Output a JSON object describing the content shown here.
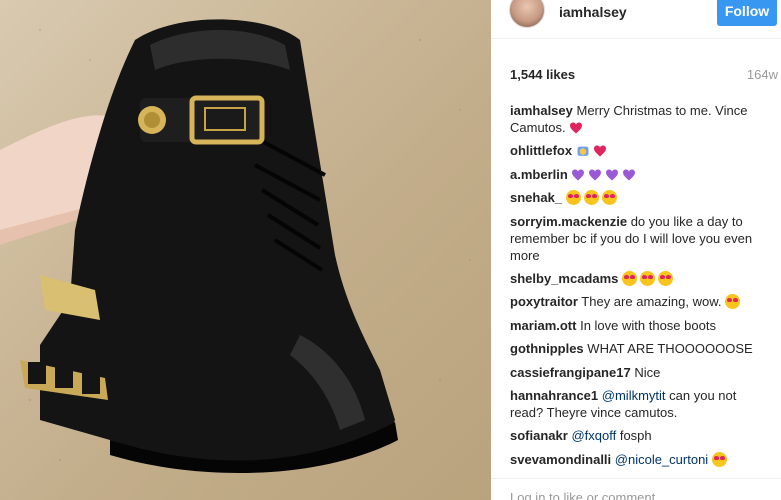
{
  "post": {
    "username": "iamhalsey",
    "follow_label": "Follow",
    "likes": "1,544 likes",
    "age": "164w"
  },
  "comments": [
    {
      "user": "iamhalsey",
      "text": "Merry Christmas to me. Vince Camutos.",
      "emoji": [
        "red-heart"
      ]
    },
    {
      "user": "ohlittlefox",
      "text": "",
      "emoji": [
        "smiling-cat",
        "red-heart"
      ]
    },
    {
      "user": "a.mberlin",
      "text": "",
      "emoji": [
        "purple-heart",
        "purple-heart",
        "purple-heart",
        "purple-heart"
      ]
    },
    {
      "user": "snehak_",
      "text": "",
      "emoji": [
        "heart-eyes",
        "heart-eyes",
        "heart-eyes"
      ]
    },
    {
      "user": "sorryim.mackenzie",
      "text": "do you like a day to remember bc if you do I will love you even more",
      "emoji": []
    },
    {
      "user": "shelby_mcadams",
      "text": "",
      "emoji": [
        "heart-eyes",
        "heart-eyes",
        "heart-eyes"
      ]
    },
    {
      "user": "poxytraitor",
      "text": "They are amazing, wow.",
      "emoji": [
        "heart-eyes"
      ]
    },
    {
      "user": "mariam.ott",
      "text": "In love with those boots",
      "emoji": []
    },
    {
      "user": "gothnipples",
      "text": "WHAT ARE THOOOOOOSE",
      "emoji": []
    },
    {
      "user": "cassiefrangipane17",
      "text": "Nice",
      "emoji": []
    },
    {
      "user": "hannahrance1",
      "mention": "@milkmytit",
      "text": "can you not read? Theyre vince camutos.",
      "emoji": []
    },
    {
      "user": "sofianakr",
      "mention": "@fxqoff",
      "text": "fosph",
      "emoji": []
    },
    {
      "user": "svevamondinalli",
      "mention": "@nicole_curtoni",
      "text": "",
      "emoji": [
        "heart-eyes"
      ]
    }
  ],
  "footer": {
    "login_link": "Log in",
    "login_suffix": "to like or comment."
  },
  "colors": {
    "accent": "#3897f0",
    "mention": "#003569",
    "muted": "#999999"
  }
}
